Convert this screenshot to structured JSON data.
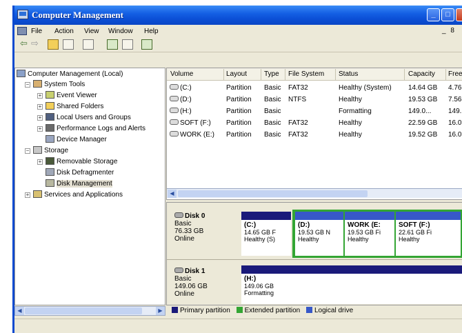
{
  "window": {
    "title": "Computer Management"
  },
  "menu": {
    "items": [
      "File",
      "Action",
      "View",
      "Window",
      "Help"
    ],
    "mdi_controls": "_ 8"
  },
  "toolbar": {
    "icons": [
      "back-icon",
      "forward-icon",
      "up-folder-icon",
      "show-hide-tree-icon",
      "properties-icon",
      "help-icon",
      "refresh-icon",
      "export-list-icon"
    ]
  },
  "tree": {
    "root": "Computer Management (Local)",
    "system_tools": "System Tools",
    "event_viewer": "Event Viewer",
    "shared_folders": "Shared Folders",
    "local_users": "Local Users and Groups",
    "perf_logs": "Performance Logs and Alerts",
    "device_manager": "Device Manager",
    "storage": "Storage",
    "removable_storage": "Removable Storage",
    "disk_defrag": "Disk Defragmenter",
    "disk_management": "Disk Management",
    "services_apps": "Services and Applications"
  },
  "volumes": {
    "headers": [
      "Volume",
      "Layout",
      "Type",
      "File System",
      "Status",
      "Capacity",
      "Free"
    ],
    "rows": [
      {
        "volume": "(C:)",
        "layout": "Partition",
        "type": "Basic",
        "fs": "FAT32",
        "status": "Healthy (System)",
        "capacity": "14.64 GB",
        "free": "4.76"
      },
      {
        "volume": "(D:)",
        "layout": "Partition",
        "type": "Basic",
        "fs": "NTFS",
        "status": "Healthy",
        "capacity": "19.53 GB",
        "free": "7.56"
      },
      {
        "volume": "(H:)",
        "layout": "Partition",
        "type": "Basic",
        "fs": "",
        "status": "Formatting",
        "capacity": "149.0...",
        "free": "149."
      },
      {
        "volume": "SOFT (F:)",
        "layout": "Partition",
        "type": "Basic",
        "fs": "FAT32",
        "status": "Healthy",
        "capacity": "22.59 GB",
        "free": "16.0"
      },
      {
        "volume": "WORK (E:)",
        "layout": "Partition",
        "type": "Basic",
        "fs": "FAT32",
        "status": "Healthy",
        "capacity": "19.52 GB",
        "free": "16.0"
      }
    ]
  },
  "disks": [
    {
      "name": "Disk 0",
      "type": "Basic",
      "size": "76.33 GB",
      "state": "Online",
      "partitions": [
        {
          "name": "(C:)",
          "size": "14.65 GB F",
          "status": "Healthy (S)"
        },
        {
          "name": "(D:)",
          "size": "19.53 GB N",
          "status": "Healthy"
        },
        {
          "name": "WORK (E:",
          "size": "19.53 GB Fi",
          "status": "Healthy"
        },
        {
          "name": "SOFT (F:)",
          "size": "22.61 GB Fi",
          "status": "Healthy"
        }
      ]
    },
    {
      "name": "Disk 1",
      "type": "Basic",
      "size": "149.06 GB",
      "state": "Online",
      "partitions": [
        {
          "name": "(H:)",
          "size": "149.06 GB",
          "status": "Formatting"
        }
      ]
    }
  ],
  "legend": {
    "primary": "Primary partition",
    "extended": "Extended partition",
    "logical": "Logical drive"
  },
  "colors": {
    "primary": "#1a1a7a",
    "extended": "#33a533",
    "logical": "#3758c8",
    "title_bar": "#0b4fd6"
  }
}
